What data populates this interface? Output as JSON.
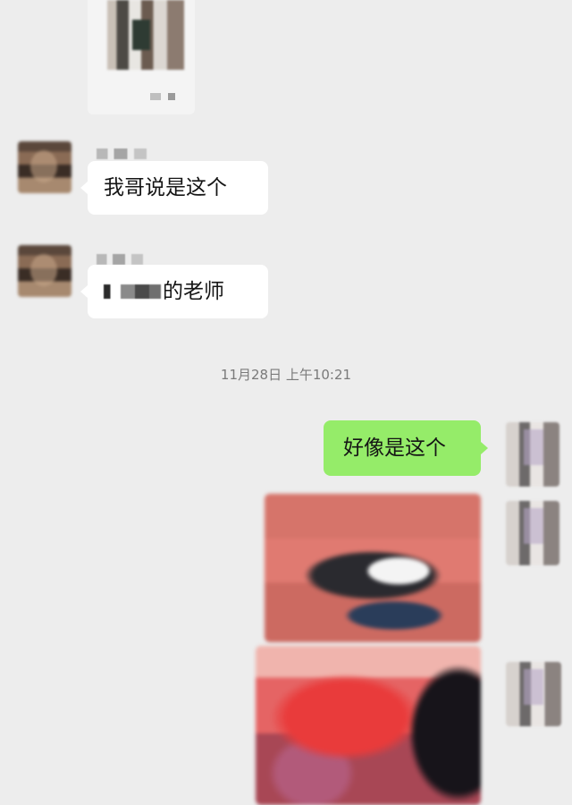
{
  "chat": {
    "messages": [
      {
        "side": "left",
        "kind": "image",
        "content_visible": false
      },
      {
        "side": "left",
        "kind": "text",
        "text": "我哥说是这个"
      },
      {
        "side": "left",
        "kind": "text",
        "text": "的老师",
        "prefix_redacted": true
      },
      {
        "side": "right",
        "kind": "text",
        "text": "好像是这个"
      },
      {
        "side": "right",
        "kind": "image"
      },
      {
        "side": "right",
        "kind": "image"
      }
    ],
    "timestamp": "11月28日 上午10:21"
  },
  "colors": {
    "background": "#ededed",
    "incoming_bubble": "#ffffff",
    "outgoing_bubble": "#95ec69",
    "timestamp_text": "#7a7a7a"
  }
}
